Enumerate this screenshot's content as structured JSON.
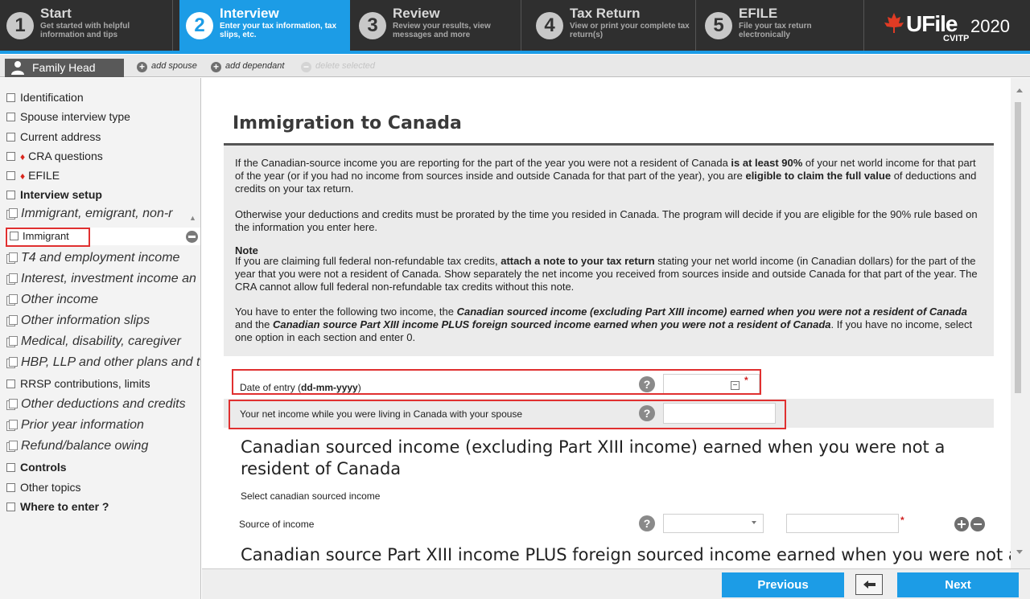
{
  "steps": [
    {
      "num": "1",
      "title": "Start",
      "sub": "Get started with helpful information and tips",
      "active": false
    },
    {
      "num": "2",
      "title": "Interview",
      "sub": "Enter your tax information, tax slips, etc.",
      "active": true
    },
    {
      "num": "3",
      "title": "Review",
      "sub": "Review your results, view messages and more",
      "active": false
    },
    {
      "num": "4",
      "title": "Tax Return",
      "sub": "View or print your complete tax return(s)",
      "active": false
    },
    {
      "num": "5",
      "title": "EFILE",
      "sub": "File your tax return electronically",
      "active": false
    }
  ],
  "logo": {
    "text": "UFile",
    "year": "2020",
    "sub": "CVITP",
    "maple_icon": "maple-leaf-icon"
  },
  "family": {
    "head_label": "Family Head",
    "add_spouse": "add spouse",
    "add_dependant": "add dependant",
    "delete_selected": "delete selected"
  },
  "nav": {
    "identification": "Identification",
    "spouse_interview_type": "Spouse interview type",
    "current_address": "Current address",
    "cra_questions": "CRA questions",
    "efile": "EFILE",
    "interview_setup": "Interview setup",
    "immigrant_section": "Immigrant, emigrant, non-r",
    "immigrant": "Immigrant",
    "t4": "T4 and employment income",
    "interest": "Interest, investment income an",
    "other_income": "Other income",
    "other_slips": "Other information slips",
    "medical": "Medical, disability, caregiver",
    "hbp": "HBP, LLP and other plans and t",
    "rrsp": "RRSP contributions, limits",
    "other_deductions": "Other deductions and credits",
    "prior_year": "Prior year information",
    "refund": "Refund/balance owing",
    "controls": "Controls",
    "other_topics": "Other topics",
    "where_to_enter": "Where to enter ?"
  },
  "main": {
    "title": "Immigration to Canada",
    "p1_a": "If the Canadian-source income you are reporting for the part of the year you were not a resident of Canada ",
    "p1_b": "is at least 90%",
    "p1_c": " of your net world income for that part of the year (or if you had no income from sources inside and outside Canada for that part of the year), you are ",
    "p1_d": "eligible to claim the full value",
    "p1_e": " of deductions and credits on your tax return.",
    "p2": "Otherwise your deductions and credits must be prorated by the time you resided in Canada. The program will decide if you are eligible for the 90% rule based on the information you enter here.",
    "note_head": "Note",
    "p3_a": " If you are claiming full federal non-refundable tax credits, ",
    "p3_b": "attach a note to your tax return",
    "p3_c": " stating your net world income (in Canadian dollars) for the part of the year that you were not a resident of Canada. Show separately the net income you received from sources inside and outside Canada for that part of the year. The CRA cannot allow full federal non-refundable tax credits without this note.",
    "p4_a": "You have to enter the following two income, the ",
    "p4_b": "Canadian sourced income (excluding Part XIII income) earned when you were not a resident of Canada",
    "p4_c": " and the ",
    "p4_d": "Canadian source Part XIII income PLUS foreign sourced income earned when you were not a resident of Canada",
    "p4_e": ". If you have no income, select one option in each section and enter 0.",
    "date_label": "Date of entry (",
    "date_format": "dd-mm-yyyy",
    "date_label_end": ")",
    "date_value": "",
    "net_income_label": "Your net income while you were living in Canada with your spouse",
    "net_income_value": "",
    "section1_title": "Canadian sourced income (excluding Part XIII income) earned when you were not a resident of Canada",
    "section1_sub": "Select canadian sourced income",
    "source_label": "Source of income",
    "source_selected": "",
    "source_amount": "",
    "section2_title": "Canadian source Part XIII income PLUS foreign sourced income earned when you were not a",
    "help_glyph": "?",
    "required_mark": "*"
  },
  "footer": {
    "previous": "Previous",
    "next": "Next"
  },
  "colors": {
    "accent": "#1c9ce6",
    "topbar": "#2f2f2f",
    "highlight_box": "#e03030",
    "maple": "#d9261c"
  }
}
